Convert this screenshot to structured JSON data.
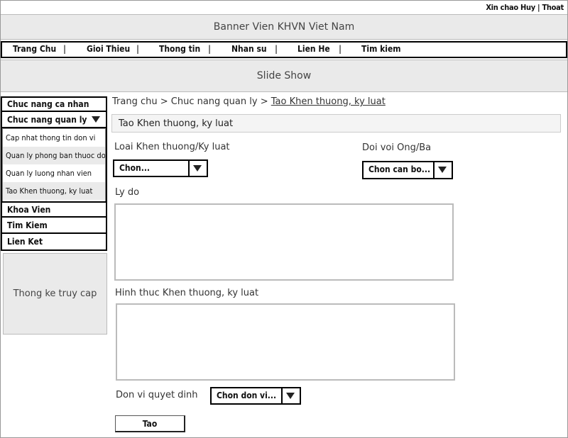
{
  "header": {
    "greeting": "Xin chao Huy",
    "separator": " | ",
    "logout": "Thoat"
  },
  "banner": {
    "text": "Banner Vien KHVN Viet Nam"
  },
  "nav": {
    "items": [
      "Trang Chu",
      "Gioi Thieu",
      "Thong tin",
      "Nhan su",
      "Lien He",
      "Tim kiem"
    ],
    "separator": "|"
  },
  "slideshow": {
    "text": "Slide Show"
  },
  "sidebar": {
    "personal": "Chuc nang ca nhan",
    "management": "Chuc nang quan ly",
    "submenu": [
      "Cap nhat thong tin don vi",
      "Quan ly phong ban thuoc don vi",
      "Quan ly luong nhan vien",
      "Tao Khen thuong, ky luat"
    ],
    "faculty": "Khoa Vien",
    "search": "Tim Kiem",
    "links": "Lien Ket",
    "stats": "Thong ke truy cap"
  },
  "breadcrumb": {
    "home": "Trang chu",
    "sep": " > ",
    "management": "Chuc nang quan ly",
    "current": "Tao Khen thuong, ky luat"
  },
  "form": {
    "title": "Tao Khen thuong, ky luat",
    "type_label": "Loai Khen thuong/Ky luat",
    "type_value": "Chon...",
    "target_label": "Doi voi Ong/Ba",
    "target_value": "Chon can bo...",
    "reason_label": "Ly do",
    "method_label": "Hinh thuc Khen thuong, ky luat",
    "unit_label": "Don vi quyet dinh",
    "unit_value": "Chon don vi...",
    "submit": "Tao"
  }
}
